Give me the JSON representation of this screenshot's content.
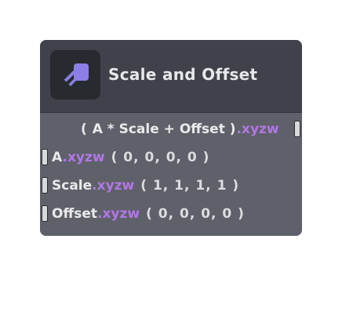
{
  "node": {
    "title": "Scale and Offset",
    "icon": "scale-offset-node-icon",
    "output": {
      "open": "(",
      "expr": "A * Scale + Offset",
      "close": ")",
      "swizzle": ".xyzw"
    },
    "inputs": [
      {
        "name": "A",
        "swizzle": ".xyzw",
        "default": "( 0, 0, 0, 0 )"
      },
      {
        "name": "Scale",
        "swizzle": ".xyzw",
        "default": "( 1, 1, 1, 1 )"
      },
      {
        "name": "Offset",
        "swizzle": ".xyzw",
        "default": "( 0, 0, 0, 0 )"
      }
    ]
  },
  "colors": {
    "accent": "#b277e6",
    "icon_fill": "#8b7fe6",
    "header": "#3f424a",
    "body": "#5e6169"
  }
}
